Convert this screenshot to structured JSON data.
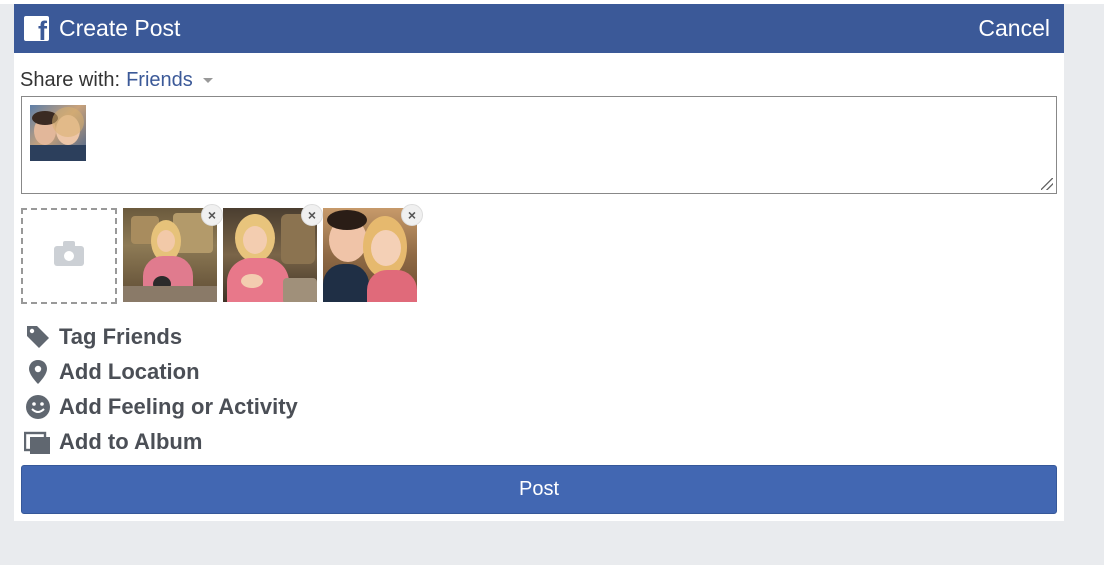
{
  "header": {
    "title": "Create Post",
    "cancel_label": "Cancel",
    "logo_icon": "facebook-icon",
    "bg_color": "#3b5998"
  },
  "share": {
    "label": "Share with:",
    "value": "Friends"
  },
  "composer": {
    "text": "",
    "avatar_icon": "profile-photo"
  },
  "photos": {
    "add_icon": "camera-icon",
    "remove_symbol": "×",
    "items": [
      {
        "description_icon": "photo-thumbnail"
      },
      {
        "description_icon": "photo-thumbnail"
      },
      {
        "description_icon": "photo-thumbnail"
      }
    ]
  },
  "actions": [
    {
      "label": "Tag Friends",
      "icon": "tag-icon"
    },
    {
      "label": "Add Location",
      "icon": "location-pin-icon"
    },
    {
      "label": "Add Feeling or Activity",
      "icon": "smiley-icon"
    },
    {
      "label": "Add to Album",
      "icon": "album-icon"
    }
  ],
  "post_button": {
    "label": "Post",
    "color": "#4267b2"
  }
}
